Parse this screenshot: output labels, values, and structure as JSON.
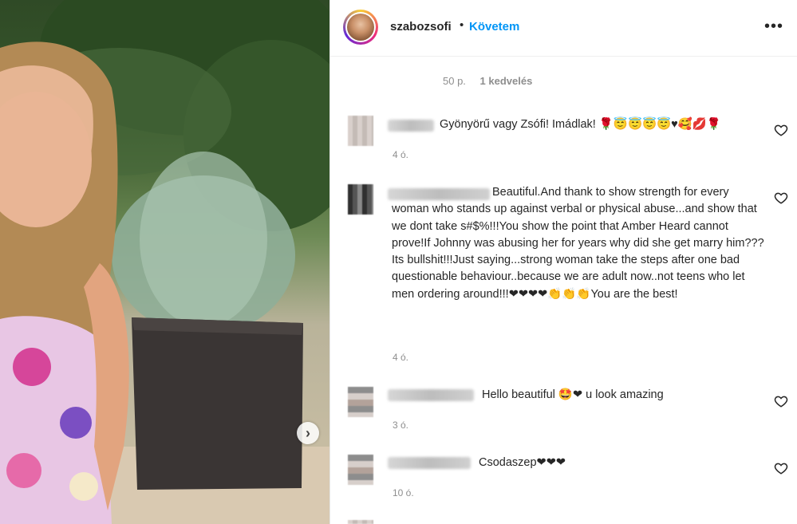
{
  "post": {
    "username": "szabozsofi",
    "separator": "•",
    "follow_label": "Követem",
    "more_icon": "•••",
    "carousel_next_icon": "›",
    "time_ago": "50 p.",
    "likes": "1 kedvelés"
  },
  "comments": [
    {
      "text": "Gyönyörű vagy Zsófi! Imádlak! 🌹😇😇😇😇♥🥰💋🌹",
      "time": "4 ó."
    },
    {
      "text": "Beautiful.And thank to show strength for every woman who stands up against verbal or physical abuse...and show that we dont take s#$%!!!You show the point that Amber Heard cannot prove!If Johnny was abusing her for years why did she get marry him???Its bullshit!!!Just saying...strong woman take the steps after one bad questionable behaviour..because we are adult now..not teens who let men ordering around!!!❤❤❤❤👏👏👏You are the best!",
      "time": "4 ó."
    },
    {
      "text": "Hello beautiful 🤩❤ u look amazing",
      "time": "3 ó."
    },
    {
      "text": "Csodaszep❤❤❤",
      "time": "10 ó."
    }
  ],
  "colors": {
    "link_blue": "#0095f6",
    "text_main": "#262626",
    "text_muted": "#8e8e8e"
  },
  "icons": {
    "like": "heart-outline-icon",
    "more": "more-horizontal-icon",
    "next": "chevron-right-icon"
  }
}
